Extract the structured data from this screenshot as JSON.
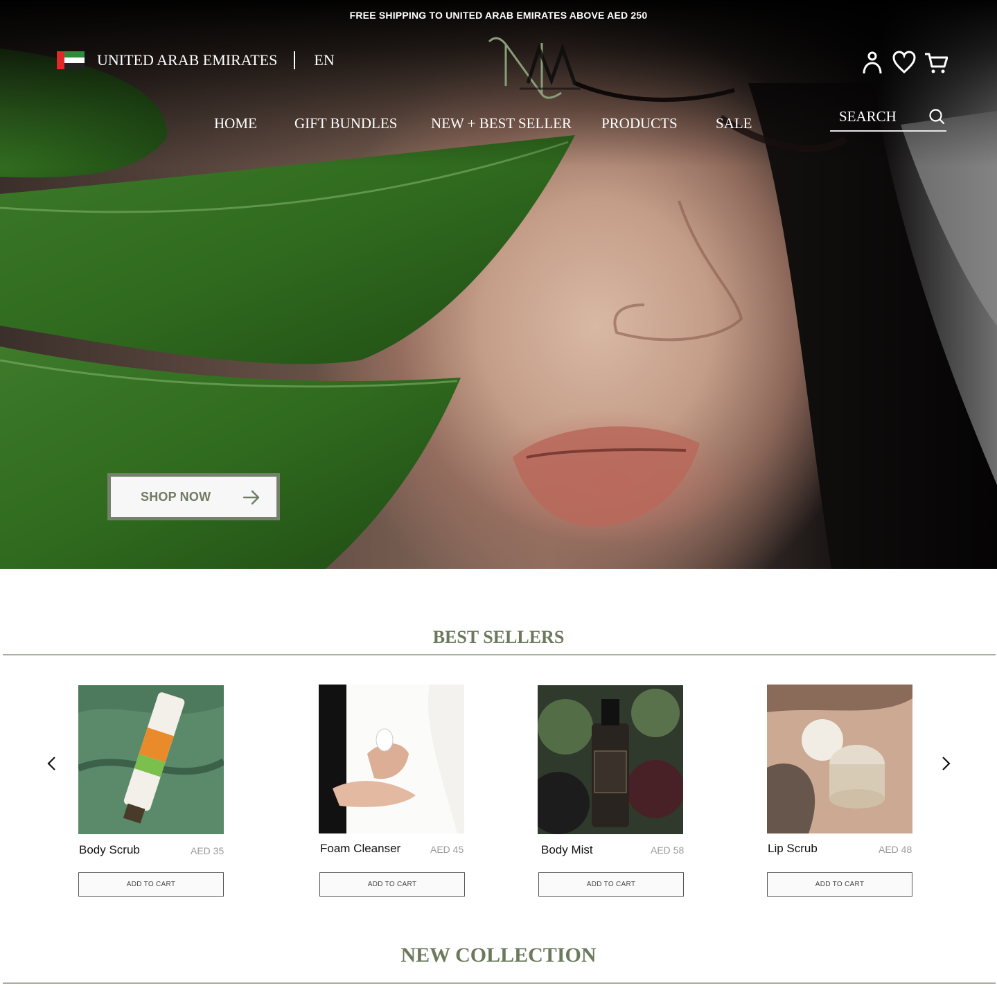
{
  "announcement": "FREE SHIPPING TO UNITED ARAB EMIRATES ABOVE AED 250",
  "region": {
    "country": "UNITED ARAB EMIRATES",
    "language": "EN"
  },
  "nav": {
    "items": [
      "HOME",
      "GIFT BUNDLES",
      "NEW + BEST SELLER",
      "PRODUCTS",
      "SALE"
    ]
  },
  "search": {
    "placeholder": "SEARCH"
  },
  "hero": {
    "cta_label": "SHOP NOW"
  },
  "best_sellers": {
    "title": "BEST SELLERS",
    "add_label": "ADD TO CART",
    "products": [
      {
        "name": "Body Scrub",
        "price": "AED 35"
      },
      {
        "name": "Foam Cleanser",
        "price": "AED 45"
      },
      {
        "name": "Body Mist",
        "price": "AED 58"
      },
      {
        "name": "Lip Scrub",
        "price": "AED 48"
      }
    ]
  },
  "new_collection": {
    "title": "NEW COLLECTION"
  },
  "icons": [
    "flag-uae-icon",
    "user-icon",
    "heart-icon",
    "cart-icon",
    "search-icon",
    "arrow-right-icon",
    "chevron-left-icon",
    "chevron-right-icon"
  ],
  "colors": {
    "accent": "#6b7a5c",
    "cta_border": "#75806d",
    "top_bar": "#000000"
  }
}
